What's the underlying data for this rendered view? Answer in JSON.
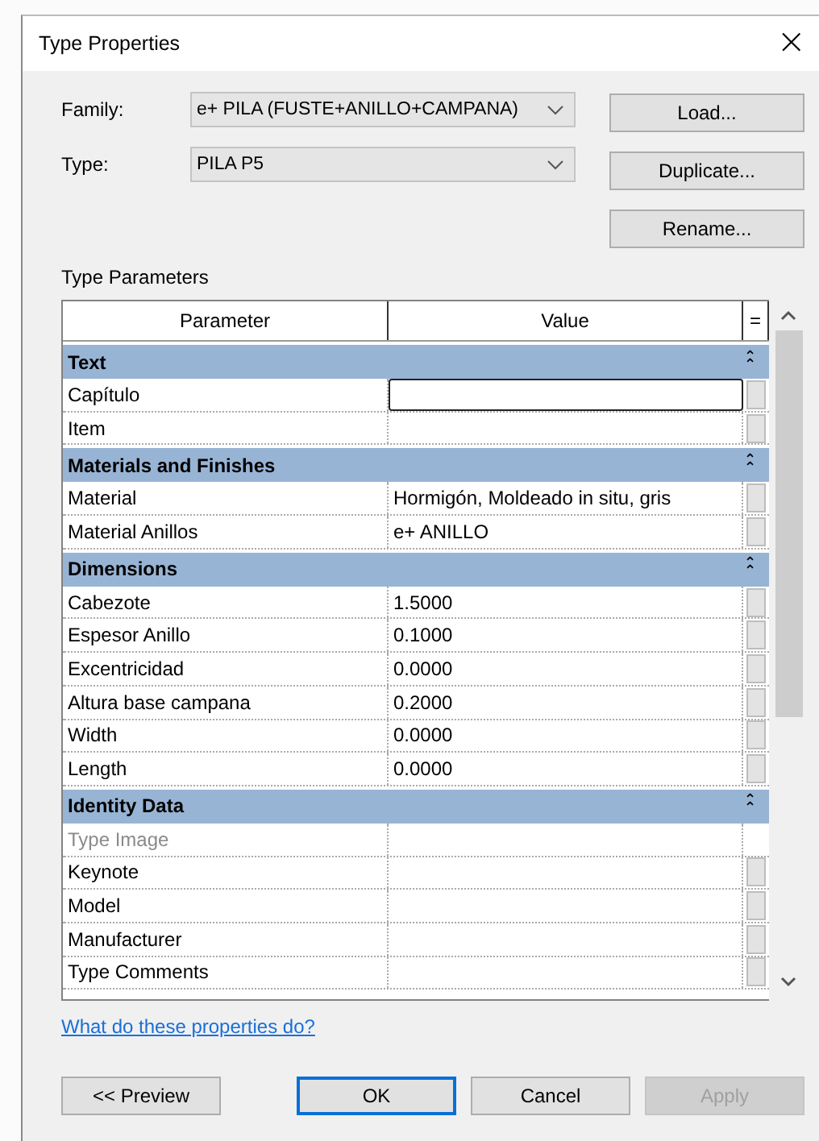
{
  "window": {
    "title": "Type Properties",
    "close": "×"
  },
  "family": {
    "label": "Family:",
    "value": "e+ PILA (FUSTE+ANILLO+CAMPANA)"
  },
  "type": {
    "label": "Type:",
    "value": "PILA P5"
  },
  "side_buttons": [
    {
      "label": "Load..."
    },
    {
      "label": "Duplicate..."
    },
    {
      "label": "Rename..."
    }
  ],
  "section_label": "Type Parameters",
  "table": {
    "columns": [
      "Parameter",
      "Value",
      "="
    ],
    "groups": [
      {
        "name": "Text",
        "collapse": "⌃",
        "rows": [
          {
            "name": "Capítulo",
            "value": "",
            "selected": true,
            "disabled": false
          },
          {
            "name": "Item",
            "value": "",
            "selected": false,
            "disabled": false
          }
        ]
      },
      {
        "name": "Materials and Finishes",
        "collapse": "⌃",
        "rows": [
          {
            "name": "Material",
            "value": "Hormigón, Moldeado in situ, gris",
            "selected": false,
            "disabled": false
          },
          {
            "name": "Material Anillos",
            "value": "e+ ANILLO",
            "selected": false,
            "disabled": false
          }
        ]
      },
      {
        "name": "Dimensions",
        "collapse": "⌃",
        "rows": [
          {
            "name": "Cabezote",
            "value": "1.5000",
            "selected": false,
            "disabled": false
          },
          {
            "name": "Espesor Anillo",
            "value": "0.1000",
            "selected": false,
            "disabled": false
          },
          {
            "name": "Excentricidad",
            "value": "0.0000",
            "selected": false,
            "disabled": false
          },
          {
            "name": "Altura base campana",
            "value": "0.2000",
            "selected": false,
            "disabled": false
          },
          {
            "name": "Width",
            "value": "0.0000",
            "selected": false,
            "disabled": false
          },
          {
            "name": "Length",
            "value": "0.0000",
            "selected": false,
            "disabled": false
          }
        ]
      },
      {
        "name": "Identity Data",
        "collapse": "⌃",
        "rows": [
          {
            "name": "Type Image",
            "value": "",
            "selected": false,
            "disabled": true
          },
          {
            "name": "Keynote",
            "value": "",
            "selected": false,
            "disabled": false
          },
          {
            "name": "Model",
            "value": "",
            "selected": false,
            "disabled": false
          },
          {
            "name": "Manufacturer",
            "value": "",
            "selected": false,
            "disabled": false
          },
          {
            "name": "Type Comments",
            "value": "",
            "selected": false,
            "disabled": false
          }
        ]
      }
    ]
  },
  "help_link": "What do these properties do?",
  "buttons": [
    {
      "label": "<< Preview",
      "selected": false,
      "disabled": false
    },
    {
      "label": "OK",
      "selected": true,
      "disabled": false
    },
    {
      "label": "Cancel",
      "selected": false,
      "disabled": false
    },
    {
      "label": "Apply",
      "selected": false,
      "disabled": true
    }
  ]
}
